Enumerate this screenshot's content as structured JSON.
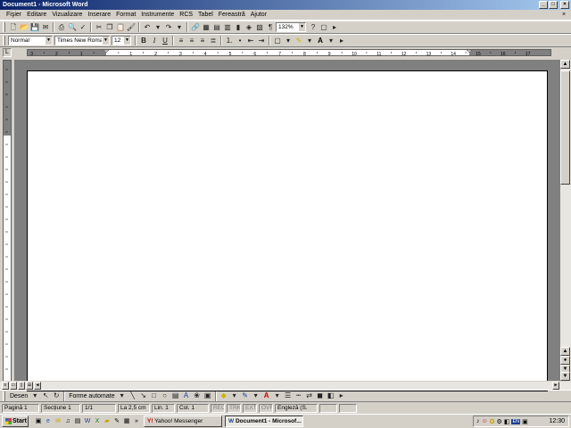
{
  "window": {
    "title": "Document1 - Microsoft Word",
    "min": "_",
    "max": "□",
    "close": "×"
  },
  "menu": [
    "Fişier",
    "Editare",
    "Vizualizare",
    "Inserare",
    "Format",
    "Instrumente",
    "RCS",
    "Tabel",
    "Fereastră",
    "Ajutor"
  ],
  "doc_close": "×",
  "standard_toolbar": {
    "zoom": "132%"
  },
  "formatting_toolbar": {
    "style": "Normal",
    "font": "Times New Roman",
    "size": "12",
    "bold": "B",
    "italic": "I",
    "underline": "U"
  },
  "ruler": {
    "labels": [
      "3",
      "2",
      "1",
      "1",
      "2",
      "3",
      "4",
      "5",
      "6",
      "7",
      "8",
      "9",
      "10",
      "11",
      "12",
      "13",
      "14",
      "15",
      "16",
      "17"
    ]
  },
  "drawing_toolbar": {
    "draw": "Desen",
    "cursor": "↖",
    "autoshapes": "Forme automate"
  },
  "status": {
    "page": "Pagină 1",
    "section": "Secțiune 1",
    "pages": "1/1",
    "at": "La 2,5 cm",
    "line": "Lin. 1",
    "col": "Col. 1",
    "rec": "REC",
    "trk": "TRK",
    "ext": "EXT",
    "ovr": "OVR",
    "lang": "Engleză (S."
  },
  "taskbar": {
    "start": "Start",
    "tasks": [
      "Yahoo! Messenger",
      "Document1 - Microsof..."
    ],
    "lang_indicator": "EN",
    "clock": "12:30"
  }
}
